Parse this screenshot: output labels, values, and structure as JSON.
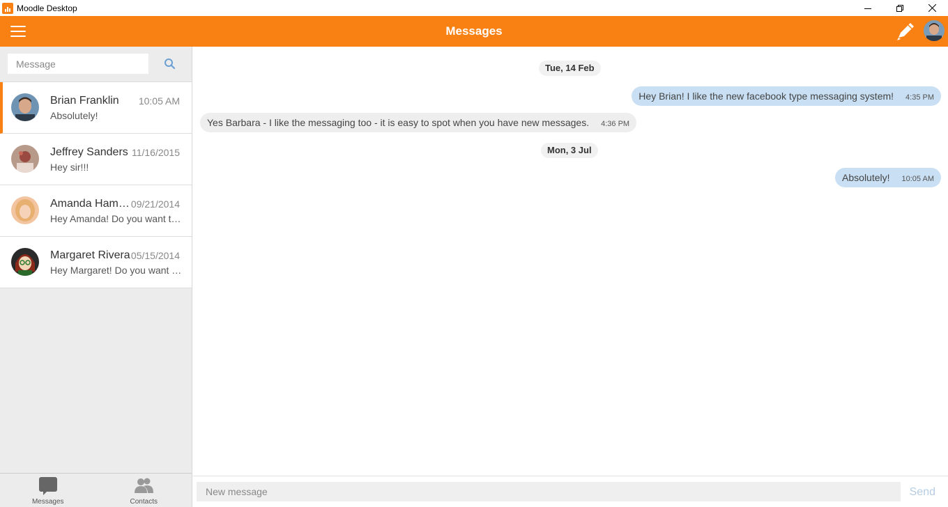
{
  "window": {
    "title": "Moodle Desktop"
  },
  "header": {
    "title": "Messages"
  },
  "search": {
    "placeholder": "Message"
  },
  "conversations": [
    {
      "name": "Brian Franklin",
      "date": "10:05 AM",
      "preview": "Absolutely!",
      "active": true
    },
    {
      "name": "Jeffrey Sanders",
      "date": "11/16/2015",
      "preview": "Hey sir!!!"
    },
    {
      "name": "Amanda Hamilton",
      "date": "09/21/2014",
      "preview": "Hey Amanda! Do you want to chat?"
    },
    {
      "name": "Margaret Rivera",
      "date": "05/15/2014",
      "preview": "Hey Margaret! Do you want to chat?"
    }
  ],
  "tabs": [
    {
      "label": "Messages"
    },
    {
      "label": "Contacts"
    }
  ],
  "thread": {
    "days": [
      {
        "label": "Tue, 14 Feb"
      },
      {
        "label": "Mon, 3 Jul"
      }
    ],
    "messages": [
      {
        "text": "Hey Brian! I like the new facebook type messaging system!",
        "time": "4:35 PM",
        "direction": "out"
      },
      {
        "text": "Yes Barbara - I like the messaging too - it is easy to spot when you have new messages.",
        "time": "4:36 PM",
        "direction": "in"
      },
      {
        "text": "Absolutely!",
        "time": "10:05 AM",
        "direction": "out"
      }
    ]
  },
  "composer": {
    "placeholder": "New message",
    "send_label": "Send"
  },
  "colors": {
    "brand": "#f98012",
    "outgoing_bubble": "#c9dff3",
    "incoming_bubble": "#eeeeee",
    "send_disabled": "#b6cde3"
  }
}
